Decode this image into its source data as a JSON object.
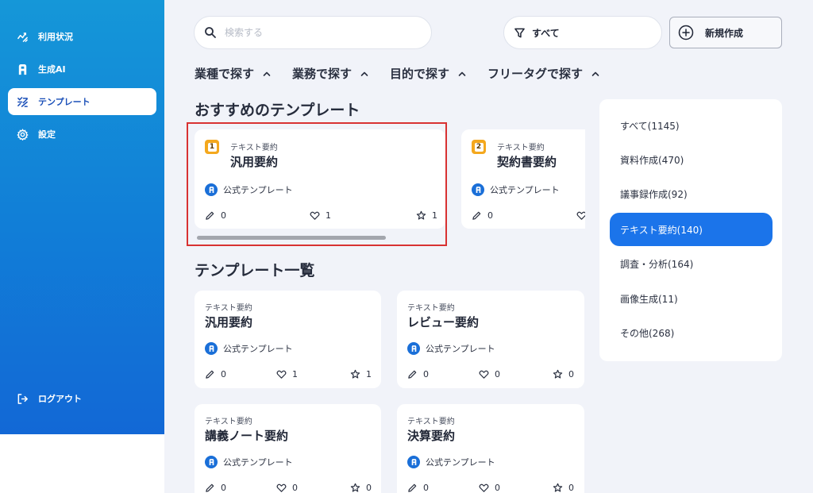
{
  "sidebar": {
    "items": [
      {
        "label": "利用状況",
        "icon": "usage-icon"
      },
      {
        "label": "生成AI",
        "icon": "ai-logo-icon"
      },
      {
        "label": "テンプレート",
        "icon": "template-icon",
        "active": true
      },
      {
        "label": "設定",
        "icon": "gear-icon"
      }
    ],
    "logout_label": "ログアウト"
  },
  "search": {
    "placeholder": "検索する"
  },
  "filter": {
    "label": "すべて"
  },
  "new_button": {
    "label": "新規作成"
  },
  "filter_tabs": [
    {
      "label": "業種で探す"
    },
    {
      "label": "業務で探す"
    },
    {
      "label": "目的で探す"
    },
    {
      "label": "フリータグで探す"
    }
  ],
  "recommended": {
    "title": "おすすめのテンプレート",
    "cards": [
      {
        "category": "テキスト要約",
        "title": "汎用要約",
        "badge": "1",
        "official": "公式テンプレート",
        "edits": "0",
        "likes": "1",
        "stars": "1"
      },
      {
        "category": "テキスト要約",
        "title": "契約書要約",
        "badge": "2",
        "official": "公式テンプレート",
        "edits": "0"
      }
    ]
  },
  "template_list": {
    "title": "テンプレート一覧",
    "cards": [
      {
        "category": "テキスト要約",
        "title": "汎用要約",
        "official": "公式テンプレート",
        "edits": "0",
        "likes": "1",
        "stars": "1"
      },
      {
        "category": "テキスト要約",
        "title": "レビュー要約",
        "official": "公式テンプレート",
        "edits": "0",
        "likes": "0",
        "stars": "0"
      },
      {
        "category": "テキスト要約",
        "title": "講義ノート要約",
        "official": "公式テンプレート",
        "edits": "0",
        "likes": "0",
        "stars": "0"
      },
      {
        "category": "テキスト要約",
        "title": "決算要約",
        "official": "公式テンプレート",
        "edits": "0",
        "likes": "0",
        "stars": "0"
      }
    ]
  },
  "categories": [
    {
      "label": "すべて(1145)"
    },
    {
      "label": "資料作成(470)"
    },
    {
      "label": "議事録作成(92)"
    },
    {
      "label": "テキスト要約(140)",
      "active": true
    },
    {
      "label": "調査・分析(164)"
    },
    {
      "label": "画像生成(11)"
    },
    {
      "label": "その他(268)"
    }
  ],
  "colors": {
    "sidebar_gradient": [
      "#1597d8",
      "#1268d6"
    ],
    "accent": "#1b74ea",
    "badge": "#f4a81e",
    "highlight": "#d83232"
  }
}
